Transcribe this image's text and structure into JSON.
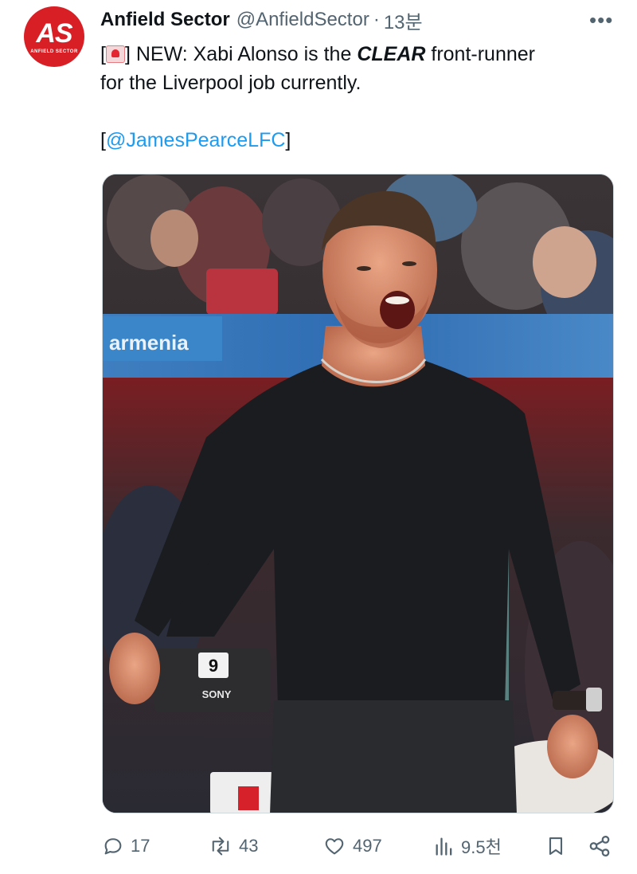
{
  "tweet": {
    "author": {
      "name": "Anfield Sector",
      "handle": "@AnfieldSector",
      "time": "13분",
      "avatar_monogram": "AS",
      "avatar_subtext": "ANFIELD SECTOR"
    },
    "more_icon": "more-horizontal-icon",
    "text": {
      "line1_before": "[",
      "siren_icon": "police-light-emoji",
      "line1_after_siren": "] NEW: Xabi Alonso is the ",
      "line1_bold": "CLEAR",
      "line1_end": " front-runner",
      "line2": "for the Liverpool job currently."
    },
    "source": {
      "open": "[",
      "mention": "@JamesPearceLFC",
      "close": "]"
    },
    "media": {
      "board_number": "9",
      "board_brand": "SONY",
      "banner_text": "armenia"
    },
    "actions": {
      "reply_count": "17",
      "retweet_count": "43",
      "like_count": "497",
      "views_count": "9.5천"
    }
  },
  "colors": {
    "accent_link": "#1d9bf0",
    "muted": "#536471",
    "avatar_red": "#d91f26"
  }
}
